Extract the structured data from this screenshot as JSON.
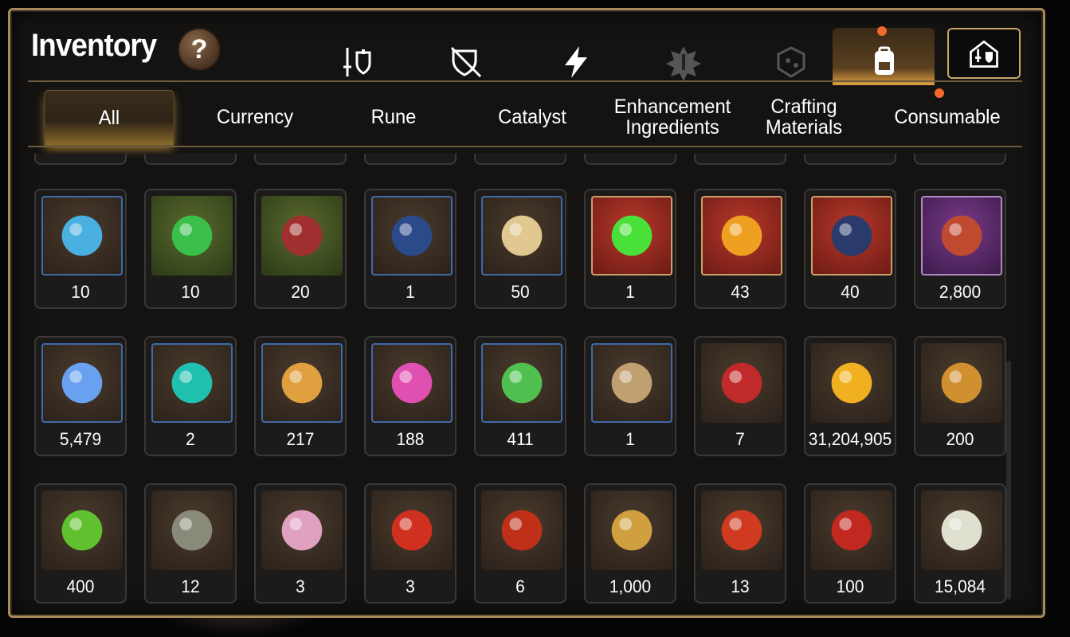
{
  "title": "Inventory",
  "help_label": "?",
  "categories": [
    {
      "name": "equipment-icon"
    },
    {
      "name": "artifact-icon"
    },
    {
      "name": "lightning-icon"
    },
    {
      "name": "emblem-icon"
    },
    {
      "name": "dice-icon"
    },
    {
      "name": "backpack-icon"
    },
    {
      "name": "storage-house-icon"
    }
  ],
  "tabs": [
    {
      "label": "All"
    },
    {
      "label": "Currency"
    },
    {
      "label": "Rune"
    },
    {
      "label": "Catalyst"
    },
    {
      "label": "Enhancement\nIngredients"
    },
    {
      "label": "Crafting\nMaterials"
    },
    {
      "label": "Consumable"
    }
  ],
  "items": [
    {
      "icon": "blue-snowflake-gem-icon",
      "qty": "10"
    },
    {
      "icon": "green-rune-gem-icon",
      "qty": "10"
    },
    {
      "icon": "claw-fang-icon",
      "qty": "20"
    },
    {
      "icon": "blue-shield-icon",
      "qty": "1"
    },
    {
      "icon": "root-herb-icon",
      "qty": "50"
    },
    {
      "icon": "green-orb-icon",
      "qty": "1"
    },
    {
      "icon": "amber-crystal-icon",
      "qty": "43"
    },
    {
      "icon": "blue-charm-icon",
      "qty": "40"
    },
    {
      "icon": "red-ring-icon",
      "qty": "2,800"
    },
    {
      "icon": "blue-crystal-icon",
      "qty": "5,479"
    },
    {
      "icon": "teal-crystal-icon",
      "qty": "2"
    },
    {
      "icon": "star-amulet-icon",
      "qty": "217"
    },
    {
      "icon": "pink-crystal-pile-icon",
      "qty": "188"
    },
    {
      "icon": "green-leaf-icon",
      "qty": "411"
    },
    {
      "icon": "pen-nib-icon",
      "qty": "1"
    },
    {
      "icon": "red-banner-icon",
      "qty": "7"
    },
    {
      "icon": "gold-coin-icon",
      "qty": "31,204,905"
    },
    {
      "icon": "gold-emblem-icon",
      "qty": "200"
    },
    {
      "icon": "green-heart-icon",
      "qty": "400"
    },
    {
      "icon": "stone-compass-icon",
      "qty": "12"
    },
    {
      "icon": "robot-orb-icon",
      "qty": "3"
    },
    {
      "icon": "red-badge-icon",
      "qty": "3"
    },
    {
      "icon": "fire-orb-icon",
      "qty": "6"
    },
    {
      "icon": "gold-fist-badge-icon",
      "qty": "1,000"
    },
    {
      "icon": "red-leaf-icon",
      "qty": "13"
    },
    {
      "icon": "red-bracelet-icon",
      "qty": "100"
    },
    {
      "icon": "chess-knight-icon",
      "qty": "15,084"
    }
  ]
}
